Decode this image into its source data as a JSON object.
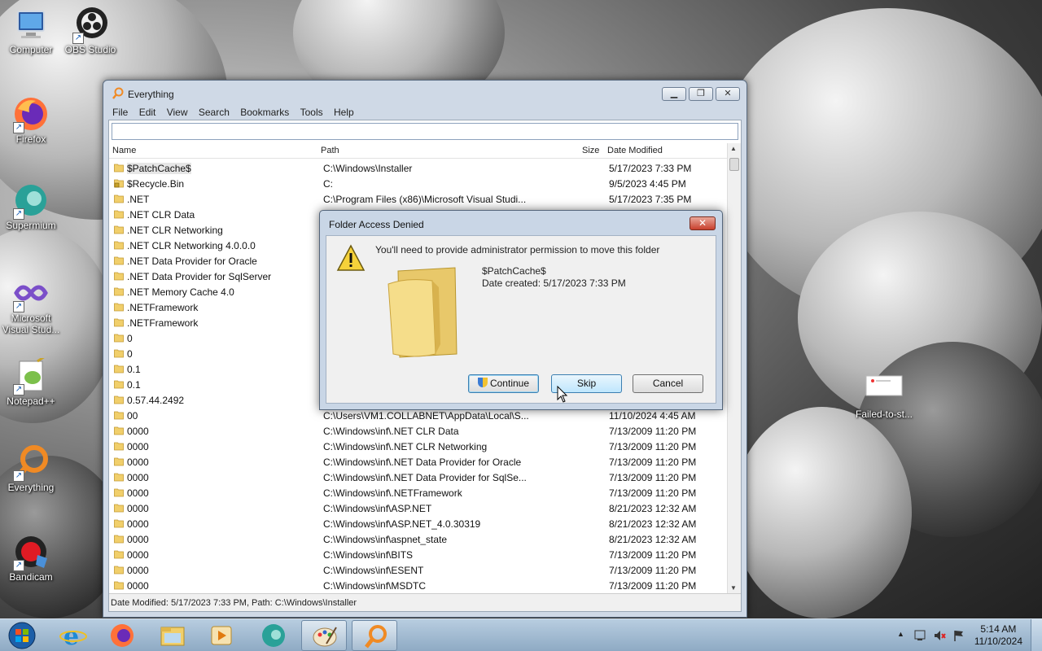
{
  "desktop": {
    "icons": [
      {
        "label": "Computer",
        "icon": "computer-icon"
      },
      {
        "label": "OBS Studio",
        "icon": "obs-icon"
      },
      {
        "label": "Firefox",
        "icon": "firefox-icon"
      },
      {
        "label": "Supermium",
        "icon": "supermium-icon"
      },
      {
        "label": "Microsoft Visual Stud...",
        "icon": "visual-studio-icon"
      },
      {
        "label": "Notepad++",
        "icon": "notepadpp-icon"
      },
      {
        "label": "Everything",
        "icon": "everything-icon"
      },
      {
        "label": "Bandicam",
        "icon": "bandicam-icon"
      },
      {
        "label": "Failed-to-st...",
        "icon": "image-file-icon"
      }
    ]
  },
  "window": {
    "title": "Everything",
    "menu": [
      "File",
      "Edit",
      "View",
      "Search",
      "Bookmarks",
      "Tools",
      "Help"
    ],
    "search_value": "",
    "columns": {
      "name": "Name",
      "path": "Path",
      "size": "Size",
      "date": "Date Modified"
    },
    "rows": [
      {
        "name": "$PatchCache$",
        "path": "C:\\Windows\\Installer",
        "date": "5/17/2023 7:33 PM",
        "icon": "folder-icon"
      },
      {
        "name": "$Recycle.Bin",
        "path": "C:",
        "date": "9/5/2023 4:45 PM",
        "icon": "folder-lock-icon"
      },
      {
        "name": ".NET",
        "path": "C:\\Program Files (x86)\\Microsoft Visual Studi...",
        "date": "5/17/2023 7:35 PM",
        "icon": "folder-icon"
      },
      {
        "name": ".NET CLR Data",
        "path": "",
        "date": "",
        "icon": "folder-icon"
      },
      {
        "name": ".NET CLR Networking",
        "path": "",
        "date": "",
        "icon": "folder-icon"
      },
      {
        "name": ".NET CLR Networking 4.0.0.0",
        "path": "",
        "date": "",
        "icon": "folder-icon"
      },
      {
        "name": ".NET Data Provider for Oracle",
        "path": "",
        "date": "",
        "icon": "folder-icon"
      },
      {
        "name": ".NET Data Provider for SqlServer",
        "path": "",
        "date": "",
        "icon": "folder-icon"
      },
      {
        "name": ".NET Memory Cache 4.0",
        "path": "",
        "date": "",
        "icon": "folder-icon"
      },
      {
        "name": ".NETFramework",
        "path": "",
        "date": "",
        "icon": "folder-icon"
      },
      {
        "name": ".NETFramework",
        "path": "",
        "date": "",
        "icon": "folder-icon"
      },
      {
        "name": "0",
        "path": "",
        "date": "",
        "icon": "folder-icon"
      },
      {
        "name": "0",
        "path": "",
        "date": "",
        "icon": "folder-icon"
      },
      {
        "name": "0.1",
        "path": "",
        "date": "",
        "icon": "folder-icon"
      },
      {
        "name": "0.1",
        "path": "",
        "date": "",
        "icon": "folder-icon"
      },
      {
        "name": "0.57.44.2492",
        "path": "",
        "date": "",
        "icon": "folder-icon"
      },
      {
        "name": "00",
        "path": "C:\\Users\\VM1.COLLABNET\\AppData\\Local\\S...",
        "date": "11/10/2024 4:45 AM",
        "icon": "folder-icon"
      },
      {
        "name": "0000",
        "path": "C:\\Windows\\inf\\.NET CLR Data",
        "date": "7/13/2009 11:20 PM",
        "icon": "folder-icon"
      },
      {
        "name": "0000",
        "path": "C:\\Windows\\inf\\.NET CLR Networking",
        "date": "7/13/2009 11:20 PM",
        "icon": "folder-icon"
      },
      {
        "name": "0000",
        "path": "C:\\Windows\\inf\\.NET Data Provider for Oracle",
        "date": "7/13/2009 11:20 PM",
        "icon": "folder-icon"
      },
      {
        "name": "0000",
        "path": "C:\\Windows\\inf\\.NET Data Provider for SqlSe...",
        "date": "7/13/2009 11:20 PM",
        "icon": "folder-icon"
      },
      {
        "name": "0000",
        "path": "C:\\Windows\\inf\\.NETFramework",
        "date": "7/13/2009 11:20 PM",
        "icon": "folder-icon"
      },
      {
        "name": "0000",
        "path": "C:\\Windows\\inf\\ASP.NET",
        "date": "8/21/2023 12:32 AM",
        "icon": "folder-icon"
      },
      {
        "name": "0000",
        "path": "C:\\Windows\\inf\\ASP.NET_4.0.30319",
        "date": "8/21/2023 12:32 AM",
        "icon": "folder-icon"
      },
      {
        "name": "0000",
        "path": "C:\\Windows\\inf\\aspnet_state",
        "date": "8/21/2023 12:32 AM",
        "icon": "folder-icon"
      },
      {
        "name": "0000",
        "path": "C:\\Windows\\inf\\BITS",
        "date": "7/13/2009 11:20 PM",
        "icon": "folder-icon"
      },
      {
        "name": "0000",
        "path": "C:\\Windows\\inf\\ESENT",
        "date": "7/13/2009 11:20 PM",
        "icon": "folder-icon"
      },
      {
        "name": "0000",
        "path": "C:\\Windows\\inf\\MSDTC",
        "date": "7/13/2009 11:20 PM",
        "icon": "folder-icon"
      }
    ],
    "status": "Date Modified: 5/17/2023 7:33 PM, Path: C:\\Windows\\Installer"
  },
  "dialog": {
    "title": "Folder Access Denied",
    "message": "You'll need to provide administrator permission to move this folder",
    "folder_name": "$PatchCache$",
    "date_created": "Date created: 5/17/2023 7:33 PM",
    "buttons": {
      "continue": "Continue",
      "skip": "Skip",
      "cancel": "Cancel"
    }
  },
  "taskbar": {
    "items": [
      "start-orb-icon",
      "internet-explorer-icon",
      "firefox-icon",
      "file-explorer-icon",
      "media-player-icon",
      "supermium-icon",
      "paint-icon",
      "everything-icon"
    ],
    "time": "5:14 AM",
    "date": "11/10/2024"
  },
  "colors": {
    "accent": "#3c7fb1",
    "taskbar": "#9fb8cf",
    "close_red": "#c8402d"
  }
}
